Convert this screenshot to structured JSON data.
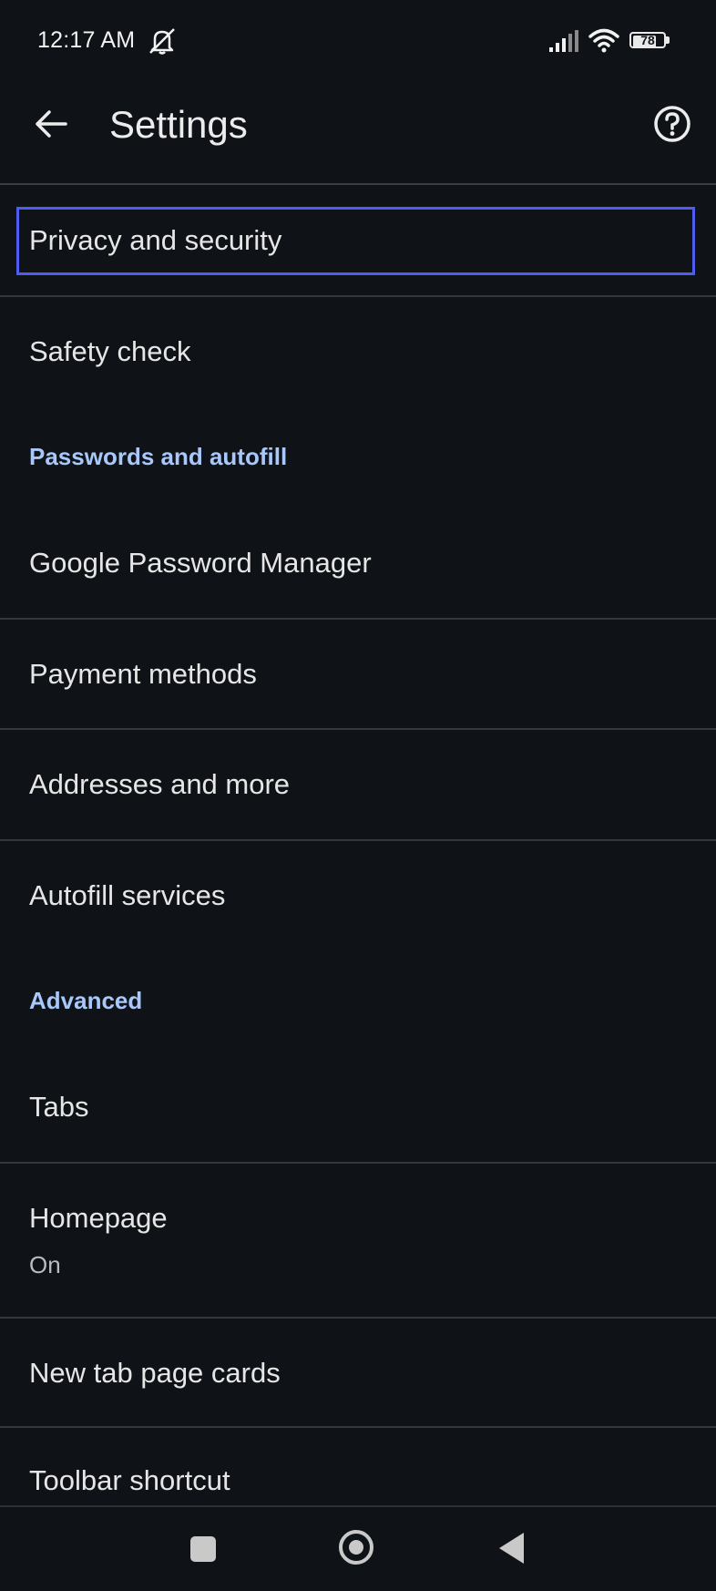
{
  "status_bar": {
    "time": "12:17 AM",
    "icons": [
      "mute-icon",
      "signal-icon",
      "wifi-icon",
      "battery-icon"
    ],
    "battery_level": "78",
    "battery_percent": 78
  },
  "app_bar": {
    "title": "Settings",
    "back_icon": "arrow-left-icon",
    "help_icon": "help-circle-icon"
  },
  "list": {
    "privacy": "Privacy and security",
    "safety_check": "Safety check",
    "section_passwords": "Passwords and autofill",
    "password_manager": "Google Password Manager",
    "payment_methods": "Payment methods",
    "addresses": "Addresses and more",
    "autofill_services": "Autofill services",
    "section_advanced": "Advanced",
    "tabs": "Tabs",
    "homepage": "Homepage",
    "homepage_status": "On",
    "new_tab_cards": "New tab page cards",
    "toolbar_shortcut": "Toolbar shortcut"
  },
  "nav_bar": {
    "icons": [
      "recents-square-icon",
      "home-circle-icon",
      "back-triangle-icon"
    ]
  },
  "colors": {
    "background": "#0f1317",
    "section_header": "#a8c7fa",
    "focus_ring": "#4f5cf0"
  }
}
